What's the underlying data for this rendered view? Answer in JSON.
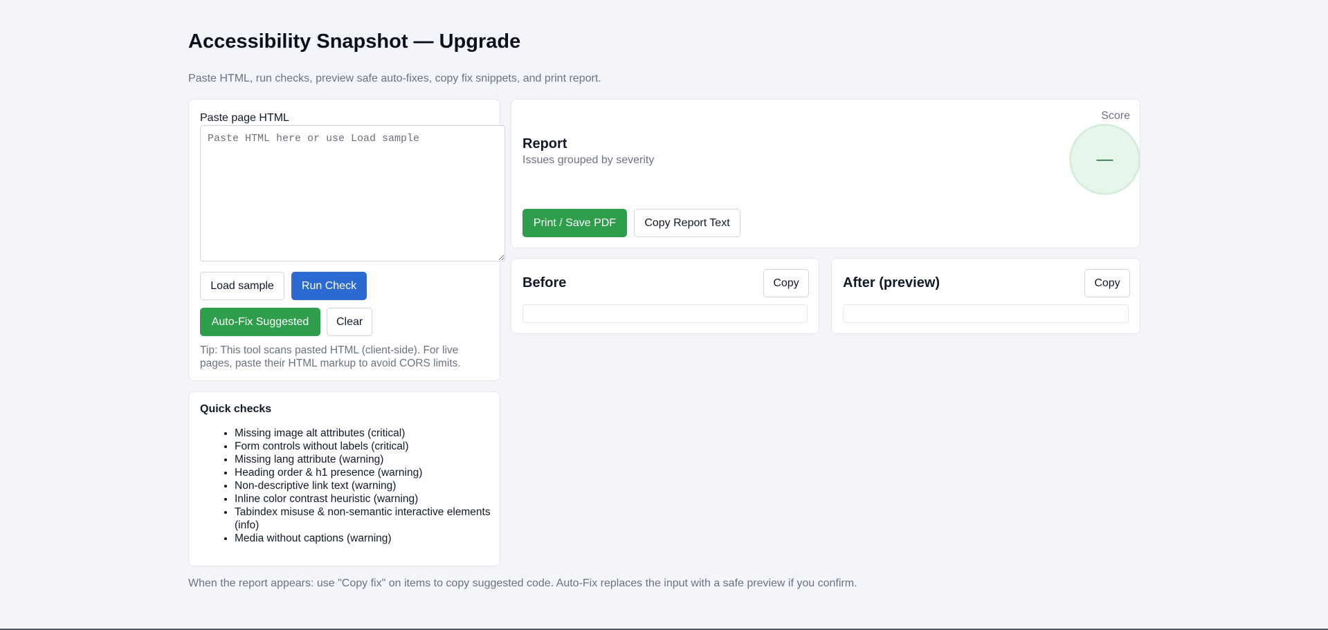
{
  "header": {
    "title": "Accessibility Snapshot — Upgrade",
    "subtitle": "Paste HTML, run checks, preview safe auto-fixes, copy fix snippets, and print report."
  },
  "input_panel": {
    "label": "Paste page HTML",
    "placeholder": "Paste HTML here or use Load sample",
    "value": "",
    "load_sample_label": "Load sample",
    "run_check_label": "Run Check",
    "autofix_label": "Auto-Fix Suggested",
    "clear_label": "Clear",
    "tip": "Tip: This tool scans pasted HTML (client-side). For live pages, paste their HTML markup to avoid CORS limits."
  },
  "quick_checks": {
    "title": "Quick checks",
    "items": [
      "Missing image alt attributes (critical)",
      "Form controls without labels (critical)",
      "Missing lang attribute (warning)",
      "Heading order & h1 presence (warning)",
      "Non-descriptive link text (warning)",
      "Inline color contrast heuristic (warning)",
      "Tabindex misuse & non-semantic interactive elements (info)",
      "Media without captions (warning)"
    ]
  },
  "report": {
    "title": "Report",
    "subtitle": "Issues grouped by severity",
    "score_label": "Score",
    "score_value": "—",
    "print_label": "Print / Save PDF",
    "copy_report_label": "Copy Report Text"
  },
  "before": {
    "title": "Before",
    "copy_label": "Copy",
    "content": ""
  },
  "after": {
    "title": "After (preview)",
    "copy_label": "Copy",
    "content": ""
  },
  "footer": {
    "note": "When the report appears: use \"Copy fix\" on items to copy suggested code. Auto-Fix replaces the input with a safe preview if you confirm."
  },
  "colors": {
    "primary": "#2b6ad0",
    "success": "#2f9e4c",
    "score_bg": "#e7f6ea",
    "background": "#f3f5fa"
  }
}
